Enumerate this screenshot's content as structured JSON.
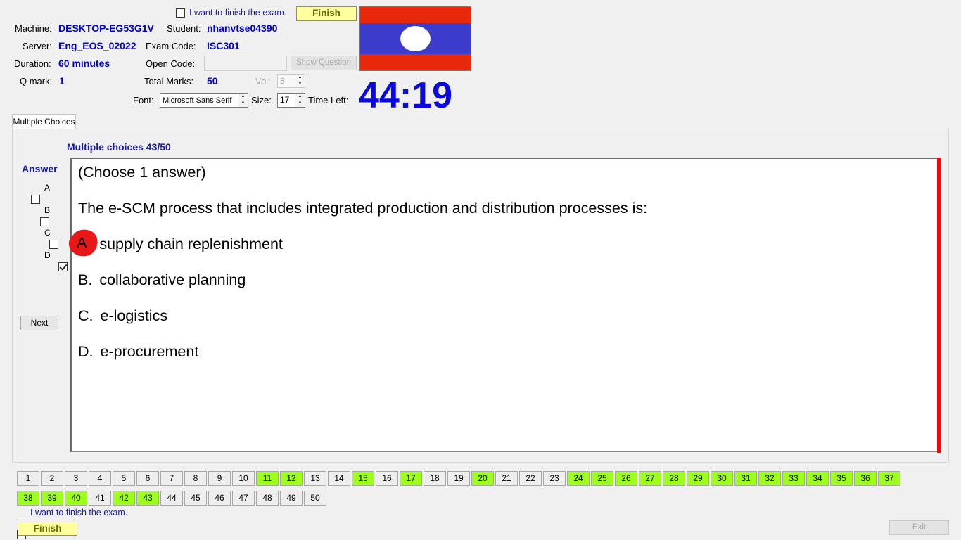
{
  "header": {
    "finish_checkbox_label": "I want to finish the exam.",
    "finish_button": "Finish",
    "machine_label": "Machine:",
    "machine_value": "DESKTOP-EG53G1V",
    "student_label": "Student:",
    "student_value": "nhanvtse04390",
    "server_label": "Server:",
    "server_value": "Eng_EOS_02022",
    "exam_code_label": "Exam Code:",
    "exam_code_value": "ISC301",
    "duration_label": "Duration:",
    "duration_value": "60 minutes",
    "open_code_label": "Open Code:",
    "open_code_value": "",
    "show_question_button": "Show Question",
    "qmark_label": "Q mark:",
    "qmark_value": "1",
    "total_marks_label": "Total Marks:",
    "total_marks_value": "50",
    "vol_label": "Vol:",
    "vol_value": "8",
    "font_label": "Font:",
    "font_value": "Microsoft Sans Serif",
    "size_label": "Size:",
    "size_value": "17",
    "time_left_label": "Time Left:",
    "time_left_value": "44:19"
  },
  "tab": {
    "label": "Multiple Choices"
  },
  "question": {
    "progress": "Multiple choices 43/50",
    "instruction": "(Choose 1 answer)",
    "text": "The e-SCM process that includes integrated production and distribution processes is:",
    "options": [
      {
        "letter": "A.",
        "text": "supply chain replenishment"
      },
      {
        "letter": "B.",
        "text": "collaborative planning"
      },
      {
        "letter": "C.",
        "text": "e-logistics"
      },
      {
        "letter": "D.",
        "text": "e-procurement"
      }
    ],
    "annotation_letter": "A"
  },
  "answer": {
    "title": "Answer",
    "options": [
      {
        "label": "A",
        "checked": false
      },
      {
        "label": "B",
        "checked": false
      },
      {
        "label": "C",
        "checked": false
      },
      {
        "label": "D",
        "checked": true
      }
    ],
    "next_button": "Next"
  },
  "navigation": {
    "answered": [
      11,
      12,
      15,
      17,
      20,
      24,
      25,
      26,
      27,
      28,
      29,
      30,
      31,
      32,
      33,
      34,
      35,
      36,
      37,
      38,
      39,
      40,
      42,
      43
    ],
    "total": 50
  },
  "footer": {
    "finish_checkbox_label": "I want to finish the exam.",
    "finish_button": "Finish",
    "exit_button": "Exit"
  },
  "colors": {
    "flag_red": "#e8280a",
    "flag_blue": "#3c3ccc",
    "answered_green": "#9eff1e",
    "timer_blue": "#0a0ae0"
  }
}
